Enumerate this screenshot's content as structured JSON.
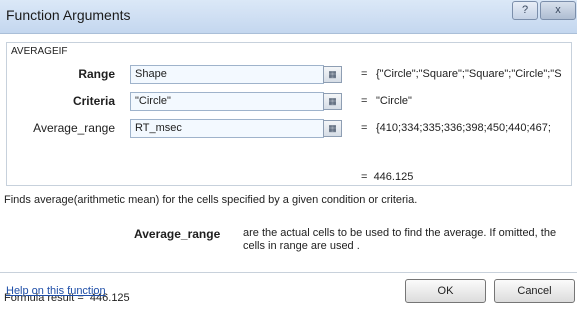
{
  "window": {
    "title": "Function Arguments",
    "help_glyph": "?",
    "close_glyph": "x"
  },
  "function": {
    "name": "AVERAGEIF",
    "args": [
      {
        "label": "Range",
        "value": "Shape",
        "result": "{\"Circle\";\"Square\";\"Square\";\"Circle\";\"S",
        "bold": true
      },
      {
        "label": "Criteria",
        "value": "\"Circle\"",
        "result": "\"Circle\"",
        "bold": true
      },
      {
        "label": "Average_range",
        "value": "RT_msec",
        "result": "{410;334;335;336;398;450;440;467;",
        "bold": false
      }
    ],
    "equals": "=",
    "result_value": "446.125",
    "description": "Finds average(arithmetic mean) for the cells specified by a given condition or criteria.",
    "arg_help_name": "Average_range",
    "arg_help_text": "are the actual cells to be used to find the average. If omitted, the cells in range are used ."
  },
  "footer": {
    "formula_result_label": "Formula result =",
    "formula_result_value": "446.125",
    "help_link": "Help on this function",
    "ok_label": "OK",
    "cancel_label": "Cancel"
  }
}
